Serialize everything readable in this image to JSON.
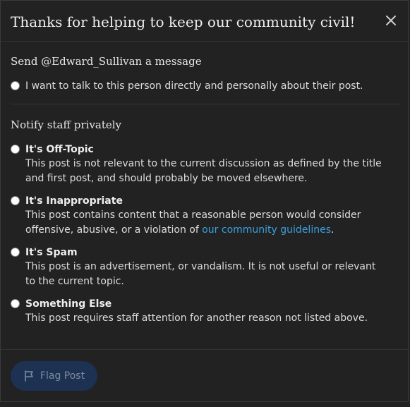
{
  "modal": {
    "title": "Thanks for helping to keep our community civil!",
    "close_icon": "close-icon"
  },
  "message_section": {
    "title": "Send @Edward_Sullivan a message",
    "option_text": "I want to talk to this person directly and personally about their post."
  },
  "notify_section": {
    "title": "Notify staff privately",
    "options": [
      {
        "label": "It's Off-Topic",
        "desc_line1": "This post is not relevant to the current discussion as defined by the title",
        "desc_line2": "and first post, and should probably be moved elsewhere."
      },
      {
        "label": "It's Inappropriate",
        "desc_line1": "This post contains content that a reasonable person would consider",
        "desc_line2_pre": "offensive, abusive, or a violation of ",
        "desc_link": "our community guidelines",
        "desc_line2_post": "."
      },
      {
        "label": "It's Spam",
        "desc_line1": "This post is an advertisement, or vandalism. It is not useful or relevant",
        "desc_line2": "to the current topic."
      },
      {
        "label": "Something Else",
        "desc_line1": "This post requires staff attention for another reason not listed above."
      }
    ]
  },
  "footer": {
    "flag_button_label": "Flag Post",
    "flag_icon": "flag-icon"
  },
  "colors": {
    "background": "#222222",
    "text": "#dddddd",
    "link": "#3aa0e0",
    "button_bg": "#1d3152",
    "button_text": "#7c8aa0"
  }
}
